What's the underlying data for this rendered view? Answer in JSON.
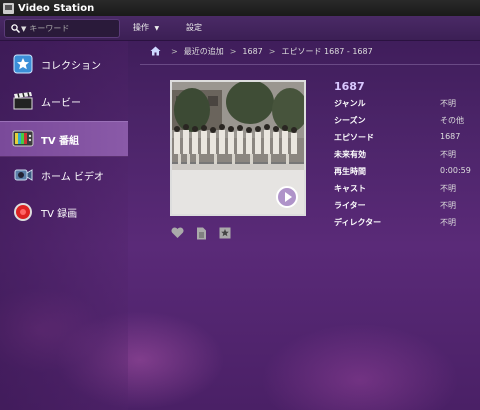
{
  "app": {
    "title": "Video Station"
  },
  "toolbar": {
    "search_placeholder": "キーワード",
    "operation_label": "操作",
    "operation_caret": "▼",
    "settings_label": "設定"
  },
  "sidebar": {
    "items": [
      {
        "label": "コレクション",
        "icon": "star-icon"
      },
      {
        "label": "ムービー",
        "icon": "clapperboard-icon"
      },
      {
        "label": "TV 番組",
        "icon": "tv-icon",
        "active": true
      },
      {
        "label": "ホーム ビデオ",
        "icon": "camcorder-icon"
      },
      {
        "label": "TV 録画",
        "icon": "record-icon"
      }
    ]
  },
  "breadcrumb": {
    "items": [
      "最近の追加",
      "1687",
      "エピソード 1687 - 1687"
    ],
    "separator": ">"
  },
  "details": {
    "title": "1687",
    "rows": [
      {
        "key": "ジャンル",
        "value": "不明"
      },
      {
        "key": "シーズン",
        "value": "その他"
      },
      {
        "key": "エピソード",
        "value": "1687"
      },
      {
        "key": "未来有効",
        "value": "不明"
      },
      {
        "key": "再生時間",
        "value": "0:00:59"
      },
      {
        "key": "キャスト",
        "value": "不明"
      },
      {
        "key": "ライター",
        "value": "不明"
      },
      {
        "key": "ディレクター",
        "value": "不明"
      }
    ]
  }
}
